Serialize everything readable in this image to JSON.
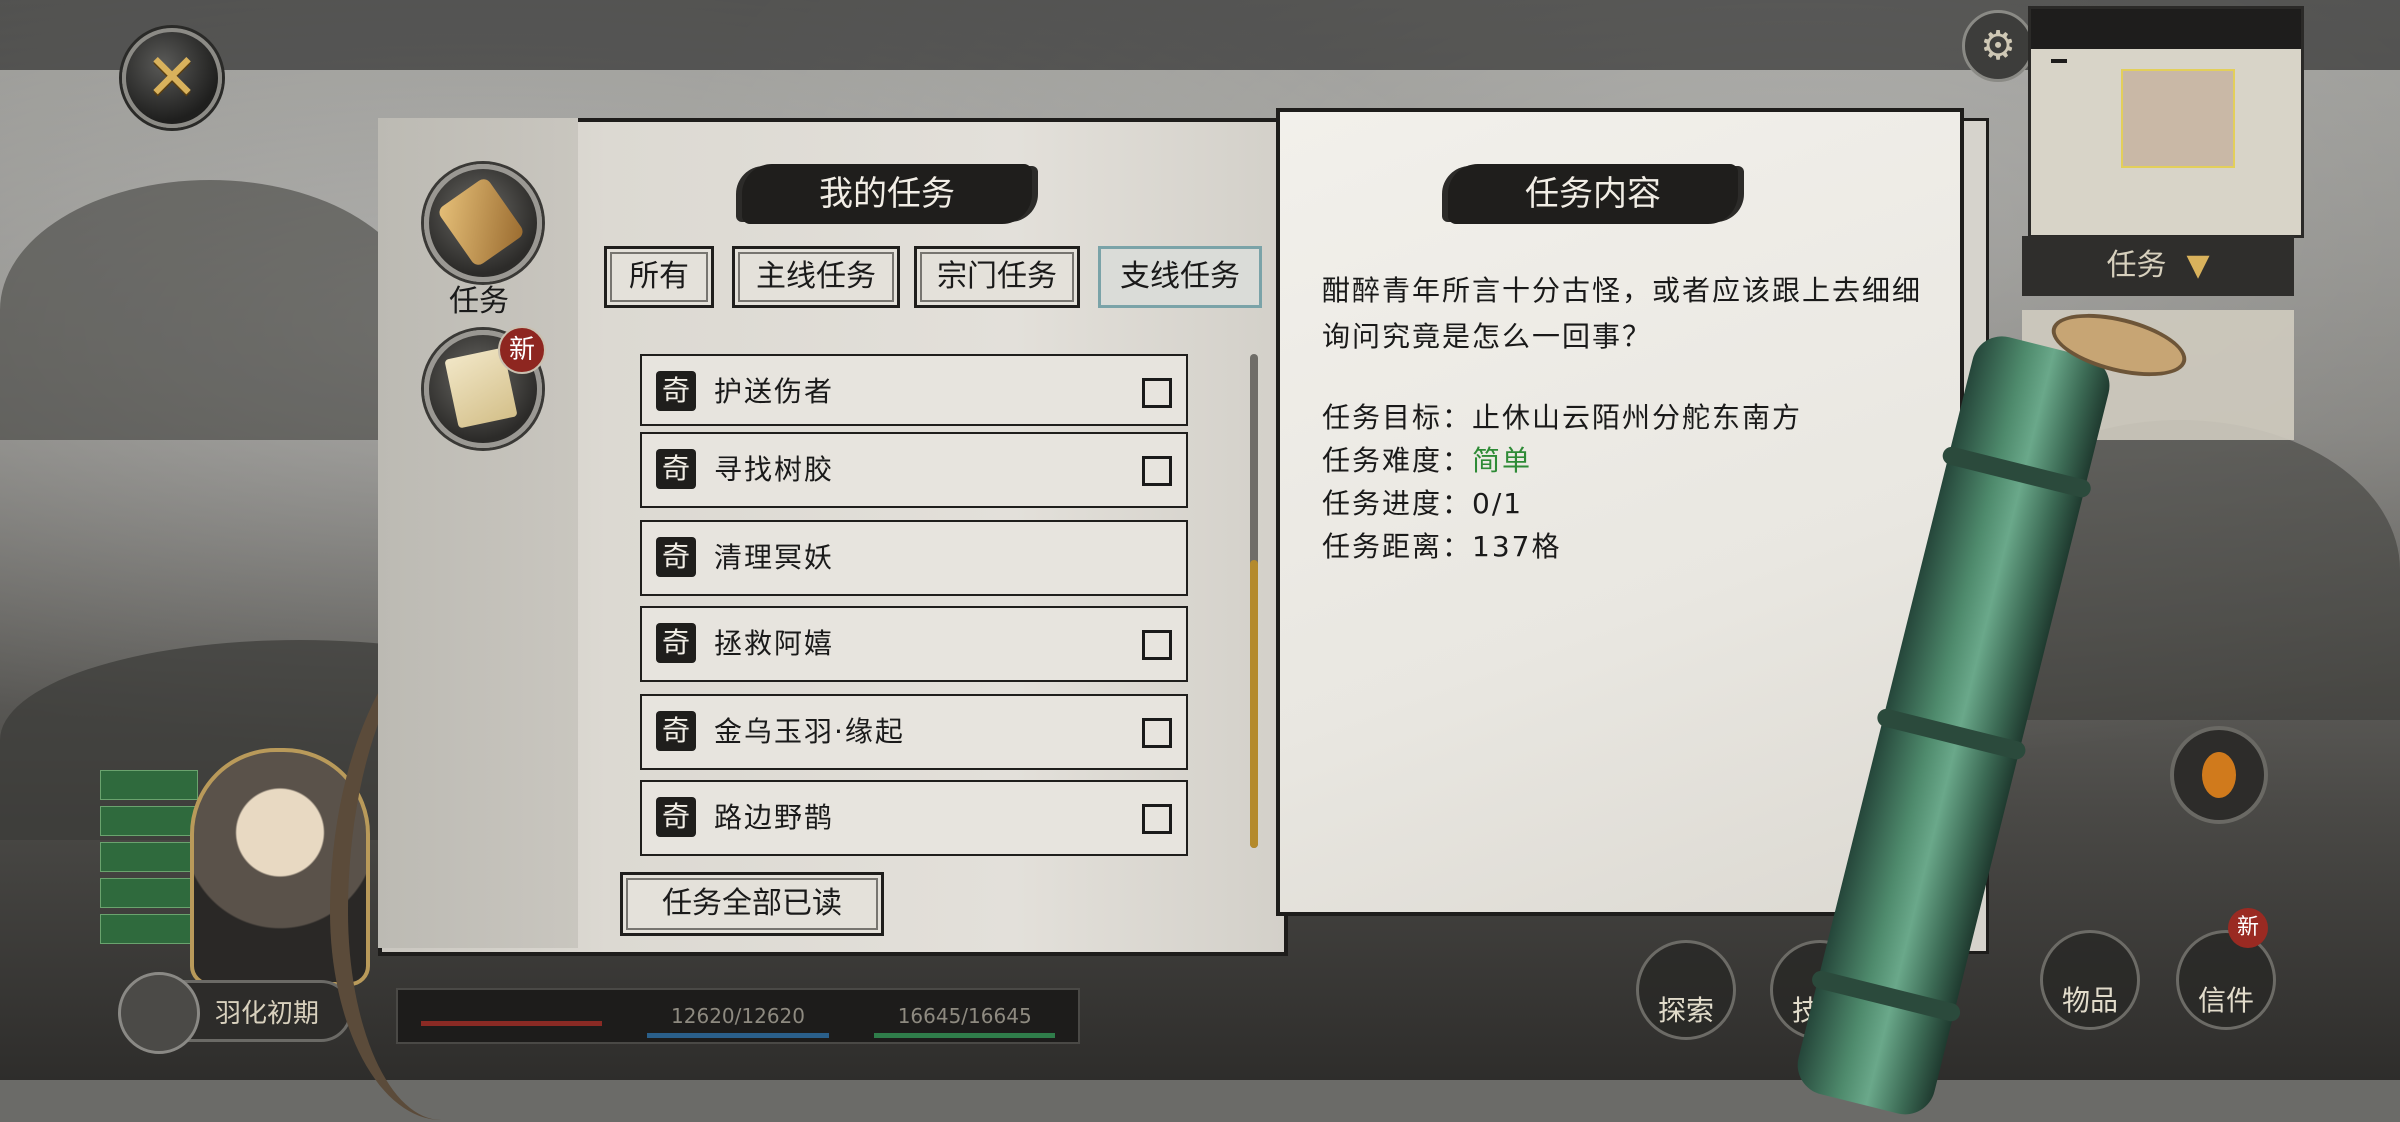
{
  "left_panel": {
    "title": "我的任务",
    "tabs": [
      {
        "label": "任务"
      },
      {
        "badge": "新"
      }
    ],
    "filters": [
      {
        "label": "所有"
      },
      {
        "label": "主线任务"
      },
      {
        "label": "宗门任务"
      },
      {
        "label": "支线任务",
        "selected": true
      }
    ],
    "quests": [
      {
        "type": "奇",
        "name": "护送伤者",
        "has_checkbox": true
      },
      {
        "type": "奇",
        "name": "寻找树胶",
        "has_checkbox": true
      },
      {
        "type": "奇",
        "name": "清理冥妖",
        "has_checkbox": false
      },
      {
        "type": "奇",
        "name": "拯救阿嬉",
        "has_checkbox": true
      },
      {
        "type": "奇",
        "name": "金乌玉羽·缘起",
        "has_checkbox": true
      },
      {
        "type": "奇",
        "name": "路边野鹊",
        "has_checkbox": true
      }
    ],
    "read_all_label": "任务全部已读"
  },
  "right_panel": {
    "title": "任务内容",
    "description": "酣醉青年所言十分古怪，或者应该跟上去细细询问究竟是怎么一回事？",
    "target": {
      "label": "任务目标：",
      "value": "止休山云陌州分舵东南方"
    },
    "difficulty": {
      "label": "任务难度：",
      "value": "简单",
      "color": "#2e8b36"
    },
    "progress": {
      "label": "任务进度：",
      "value": "0/1"
    },
    "distance": {
      "label": "任务距离：",
      "value": "137格"
    }
  },
  "hud": {
    "minimap_header": "",
    "minimap_tag": "",
    "task_dropdown": "任务",
    "rank": "羽化初期",
    "hp": "",
    "mp": "12620/12620",
    "sp": "16645/16645",
    "buttons": [
      "探索",
      "技能",
      "物品",
      "信件"
    ],
    "letter_badge": "新"
  },
  "colors": {
    "ink": "#1f1e1c",
    "paper": "#e4e1da",
    "scroll_thumb": "#b48a2c",
    "easy_green": "#2e8b36"
  }
}
